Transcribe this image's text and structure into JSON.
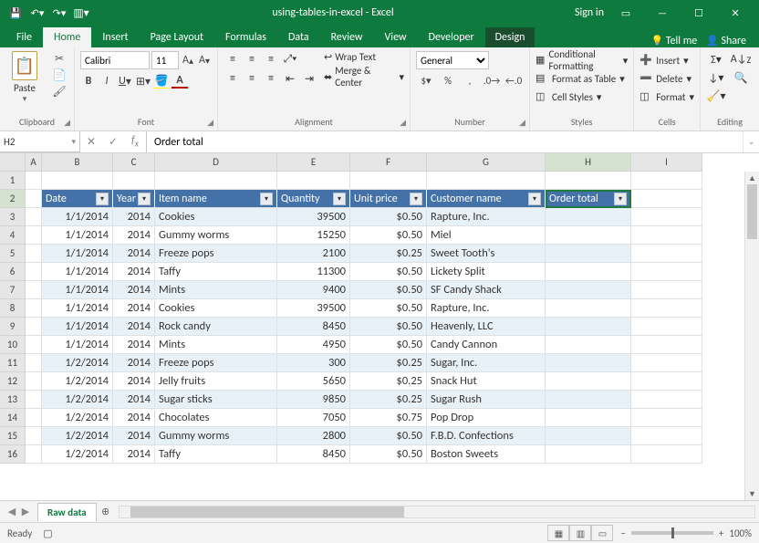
{
  "window": {
    "title": "using-tables-in-excel - Excel",
    "signin": "Sign in"
  },
  "tabs": {
    "file": "File",
    "home": "Home",
    "insert": "Insert",
    "pagelayout": "Page Layout",
    "formulas": "Formulas",
    "data": "Data",
    "review": "Review",
    "view": "View",
    "developer": "Developer",
    "design": "Design",
    "tellme": "Tell me",
    "share": "Share"
  },
  "ribbon": {
    "clipboard": {
      "paste": "Paste",
      "label": "Clipboard"
    },
    "font": {
      "name": "Calibri",
      "size": "11",
      "label": "Font"
    },
    "alignment": {
      "wrap": "Wrap Text",
      "merge": "Merge & Center",
      "label": "Alignment"
    },
    "number": {
      "format": "General",
      "label": "Number"
    },
    "styles": {
      "cond": "Conditional Formatting",
      "table": "Format as Table",
      "cell": "Cell Styles",
      "label": "Styles"
    },
    "cells": {
      "insert": "Insert",
      "delete": "Delete",
      "format": "Format",
      "label": "Cells"
    },
    "editing": {
      "label": "Editing"
    }
  },
  "namebox": "H2",
  "formula": "Order total",
  "columns": [
    "A",
    "B",
    "C",
    "D",
    "E",
    "F",
    "G",
    "H",
    "I"
  ],
  "headers": {
    "date": "Date",
    "year": "Year",
    "item": "Item name",
    "qty": "Quantity",
    "price": "Unit price",
    "cust": "Customer name",
    "total": "Order total"
  },
  "rows": [
    {
      "n": 3,
      "date": "1/1/2014",
      "year": "2014",
      "item": "Cookies",
      "qty": "39500",
      "price": "$0.50",
      "cust": "Rapture, Inc."
    },
    {
      "n": 4,
      "date": "1/1/2014",
      "year": "2014",
      "item": "Gummy worms",
      "qty": "15250",
      "price": "$0.50",
      "cust": "Miel"
    },
    {
      "n": 5,
      "date": "1/1/2014",
      "year": "2014",
      "item": "Freeze pops",
      "qty": "2100",
      "price": "$0.25",
      "cust": "Sweet Tooth's"
    },
    {
      "n": 6,
      "date": "1/1/2014",
      "year": "2014",
      "item": "Taffy",
      "qty": "11300",
      "price": "$0.50",
      "cust": "Lickety Split"
    },
    {
      "n": 7,
      "date": "1/1/2014",
      "year": "2014",
      "item": "Mints",
      "qty": "9400",
      "price": "$0.50",
      "cust": "SF Candy Shack"
    },
    {
      "n": 8,
      "date": "1/1/2014",
      "year": "2014",
      "item": "Cookies",
      "qty": "39500",
      "price": "$0.50",
      "cust": "Rapture, Inc."
    },
    {
      "n": 9,
      "date": "1/1/2014",
      "year": "2014",
      "item": "Rock candy",
      "qty": "8450",
      "price": "$0.50",
      "cust": "Heavenly, LLC"
    },
    {
      "n": 10,
      "date": "1/1/2014",
      "year": "2014",
      "item": "Mints",
      "qty": "4950",
      "price": "$0.50",
      "cust": "Candy Cannon"
    },
    {
      "n": 11,
      "date": "1/2/2014",
      "year": "2014",
      "item": "Freeze pops",
      "qty": "300",
      "price": "$0.25",
      "cust": "Sugar, Inc."
    },
    {
      "n": 12,
      "date": "1/2/2014",
      "year": "2014",
      "item": "Jelly fruits",
      "qty": "5650",
      "price": "$0.25",
      "cust": "Snack Hut"
    },
    {
      "n": 13,
      "date": "1/2/2014",
      "year": "2014",
      "item": "Sugar sticks",
      "qty": "9850",
      "price": "$0.25",
      "cust": "Sugar Rush"
    },
    {
      "n": 14,
      "date": "1/2/2014",
      "year": "2014",
      "item": "Chocolates",
      "qty": "7050",
      "price": "$0.75",
      "cust": "Pop Drop"
    },
    {
      "n": 15,
      "date": "1/2/2014",
      "year": "2014",
      "item": "Gummy worms",
      "qty": "2800",
      "price": "$0.50",
      "cust": "F.B.D. Confections"
    },
    {
      "n": 16,
      "date": "1/2/2014",
      "year": "2014",
      "item": "Taffy",
      "qty": "8450",
      "price": "$0.50",
      "cust": "Boston Sweets"
    }
  ],
  "sheet": "Raw data",
  "status": {
    "ready": "Ready",
    "zoom": "100%"
  }
}
